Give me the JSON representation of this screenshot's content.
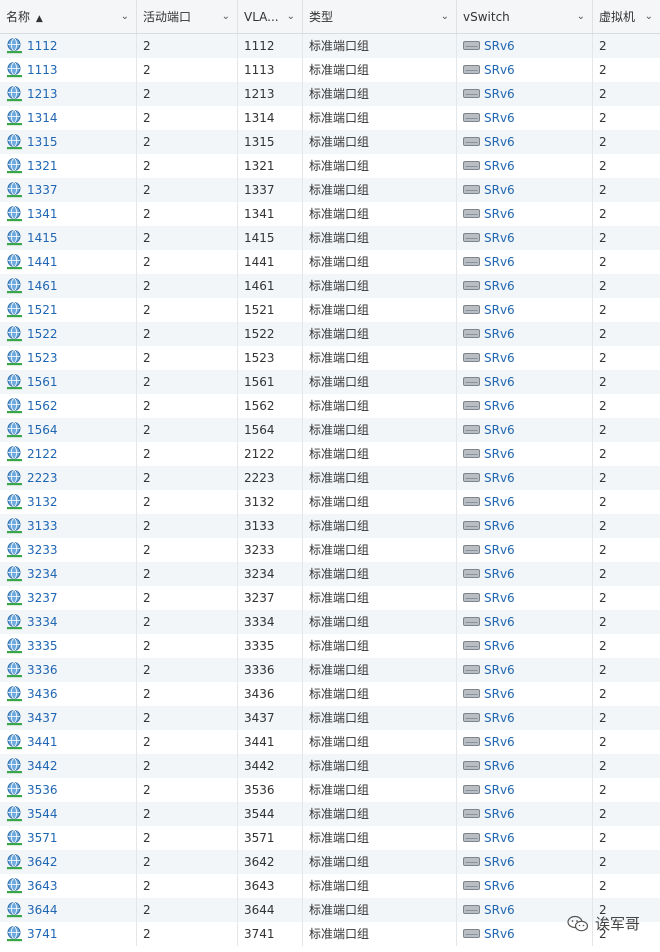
{
  "header": {
    "columns": [
      {
        "label": "名称",
        "sort": "▲"
      },
      {
        "label": "活动端口"
      },
      {
        "label": "VLA..."
      },
      {
        "label": "类型"
      },
      {
        "label": "vSwitch"
      },
      {
        "label": "虚拟机"
      }
    ]
  },
  "icons": {
    "portgroup": "portgroup-globe-icon",
    "vswitch": "vswitch-icon",
    "chevron": "chevron-down-icon"
  },
  "colors": {
    "link": "#1f66b3",
    "stripe": "#f3f6f9"
  },
  "rows": [
    {
      "name": "1112",
      "active": "2",
      "vlan": "1112",
      "type": "标准端口组",
      "vswitch": "SRv6",
      "vms": "2"
    },
    {
      "name": "1113",
      "active": "2",
      "vlan": "1113",
      "type": "标准端口组",
      "vswitch": "SRv6",
      "vms": "2"
    },
    {
      "name": "1213",
      "active": "2",
      "vlan": "1213",
      "type": "标准端口组",
      "vswitch": "SRv6",
      "vms": "2"
    },
    {
      "name": "1314",
      "active": "2",
      "vlan": "1314",
      "type": "标准端口组",
      "vswitch": "SRv6",
      "vms": "2"
    },
    {
      "name": "1315",
      "active": "2",
      "vlan": "1315",
      "type": "标准端口组",
      "vswitch": "SRv6",
      "vms": "2"
    },
    {
      "name": "1321",
      "active": "2",
      "vlan": "1321",
      "type": "标准端口组",
      "vswitch": "SRv6",
      "vms": "2"
    },
    {
      "name": "1337",
      "active": "2",
      "vlan": "1337",
      "type": "标准端口组",
      "vswitch": "SRv6",
      "vms": "2"
    },
    {
      "name": "1341",
      "active": "2",
      "vlan": "1341",
      "type": "标准端口组",
      "vswitch": "SRv6",
      "vms": "2"
    },
    {
      "name": "1415",
      "active": "2",
      "vlan": "1415",
      "type": "标准端口组",
      "vswitch": "SRv6",
      "vms": "2"
    },
    {
      "name": "1441",
      "active": "2",
      "vlan": "1441",
      "type": "标准端口组",
      "vswitch": "SRv6",
      "vms": "2"
    },
    {
      "name": "1461",
      "active": "2",
      "vlan": "1461",
      "type": "标准端口组",
      "vswitch": "SRv6",
      "vms": "2"
    },
    {
      "name": "1521",
      "active": "2",
      "vlan": "1521",
      "type": "标准端口组",
      "vswitch": "SRv6",
      "vms": "2"
    },
    {
      "name": "1522",
      "active": "2",
      "vlan": "1522",
      "type": "标准端口组",
      "vswitch": "SRv6",
      "vms": "2"
    },
    {
      "name": "1523",
      "active": "2",
      "vlan": "1523",
      "type": "标准端口组",
      "vswitch": "SRv6",
      "vms": "2"
    },
    {
      "name": "1561",
      "active": "2",
      "vlan": "1561",
      "type": "标准端口组",
      "vswitch": "SRv6",
      "vms": "2"
    },
    {
      "name": "1562",
      "active": "2",
      "vlan": "1562",
      "type": "标准端口组",
      "vswitch": "SRv6",
      "vms": "2"
    },
    {
      "name": "1564",
      "active": "2",
      "vlan": "1564",
      "type": "标准端口组",
      "vswitch": "SRv6",
      "vms": "2"
    },
    {
      "name": "2122",
      "active": "2",
      "vlan": "2122",
      "type": "标准端口组",
      "vswitch": "SRv6",
      "vms": "2"
    },
    {
      "name": "2223",
      "active": "2",
      "vlan": "2223",
      "type": "标准端口组",
      "vswitch": "SRv6",
      "vms": "2"
    },
    {
      "name": "3132",
      "active": "2",
      "vlan": "3132",
      "type": "标准端口组",
      "vswitch": "SRv6",
      "vms": "2"
    },
    {
      "name": "3133",
      "active": "2",
      "vlan": "3133",
      "type": "标准端口组",
      "vswitch": "SRv6",
      "vms": "2"
    },
    {
      "name": "3233",
      "active": "2",
      "vlan": "3233",
      "type": "标准端口组",
      "vswitch": "SRv6",
      "vms": "2"
    },
    {
      "name": "3234",
      "active": "2",
      "vlan": "3234",
      "type": "标准端口组",
      "vswitch": "SRv6",
      "vms": "2"
    },
    {
      "name": "3237",
      "active": "2",
      "vlan": "3237",
      "type": "标准端口组",
      "vswitch": "SRv6",
      "vms": "2"
    },
    {
      "name": "3334",
      "active": "2",
      "vlan": "3334",
      "type": "标准端口组",
      "vswitch": "SRv6",
      "vms": "2"
    },
    {
      "name": "3335",
      "active": "2",
      "vlan": "3335",
      "type": "标准端口组",
      "vswitch": "SRv6",
      "vms": "2"
    },
    {
      "name": "3336",
      "active": "2",
      "vlan": "3336",
      "type": "标准端口组",
      "vswitch": "SRv6",
      "vms": "2"
    },
    {
      "name": "3436",
      "active": "2",
      "vlan": "3436",
      "type": "标准端口组",
      "vswitch": "SRv6",
      "vms": "2"
    },
    {
      "name": "3437",
      "active": "2",
      "vlan": "3437",
      "type": "标准端口组",
      "vswitch": "SRv6",
      "vms": "2"
    },
    {
      "name": "3441",
      "active": "2",
      "vlan": "3441",
      "type": "标准端口组",
      "vswitch": "SRv6",
      "vms": "2"
    },
    {
      "name": "3442",
      "active": "2",
      "vlan": "3442",
      "type": "标准端口组",
      "vswitch": "SRv6",
      "vms": "2"
    },
    {
      "name": "3536",
      "active": "2",
      "vlan": "3536",
      "type": "标准端口组",
      "vswitch": "SRv6",
      "vms": "2"
    },
    {
      "name": "3544",
      "active": "2",
      "vlan": "3544",
      "type": "标准端口组",
      "vswitch": "SRv6",
      "vms": "2"
    },
    {
      "name": "3571",
      "active": "2",
      "vlan": "3571",
      "type": "标准端口组",
      "vswitch": "SRv6",
      "vms": "2"
    },
    {
      "name": "3642",
      "active": "2",
      "vlan": "3642",
      "type": "标准端口组",
      "vswitch": "SRv6",
      "vms": "2"
    },
    {
      "name": "3643",
      "active": "2",
      "vlan": "3643",
      "type": "标准端口组",
      "vswitch": "SRv6",
      "vms": "2"
    },
    {
      "name": "3644",
      "active": "2",
      "vlan": "3644",
      "type": "标准端口组",
      "vswitch": "SRv6",
      "vms": "2"
    },
    {
      "name": "3741",
      "active": "2",
      "vlan": "3741",
      "type": "标准端口组",
      "vswitch": "SRv6",
      "vms": "2"
    }
  ],
  "watermark": {
    "text": "诶军哥",
    "icon": "wechat-icon"
  }
}
